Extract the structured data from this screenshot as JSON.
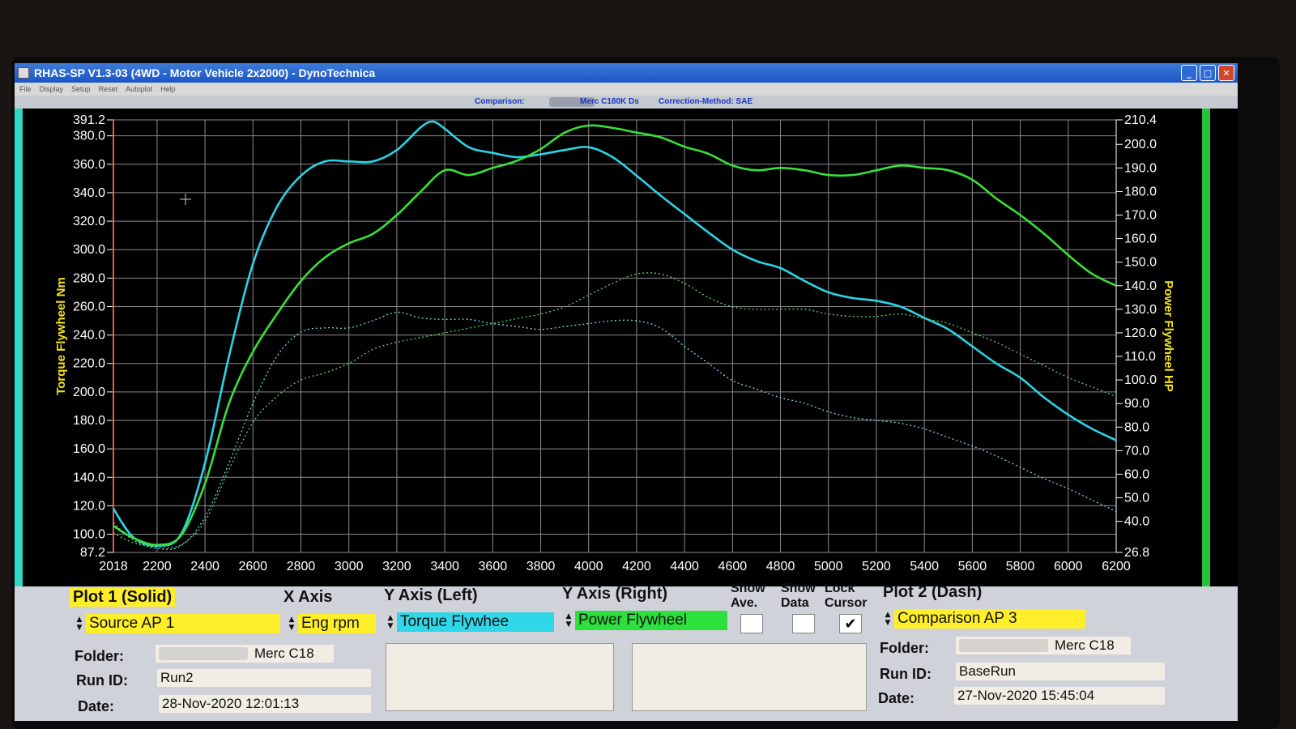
{
  "window": {
    "title": "RHAS-SP V1.3-03  (4WD - Motor Vehicle 2x2000) - DynoTechnica",
    "menu": [
      "File",
      "Display",
      "Setup",
      "Reset",
      "Autoplot",
      "Help"
    ]
  },
  "infobar": {
    "comparison_label": "Comparison:",
    "comparison_value": "Merc C180K Ds",
    "correction_label": "Correction-Method: SAE"
  },
  "chart_data": {
    "type": "line",
    "xlabel": "",
    "ylabel": "Torque Flywheel Nm",
    "y2label": "Power Flywheel HP",
    "xlim": [
      2018,
      6200
    ],
    "ylim": [
      87.2,
      391.2
    ],
    "y2lim": [
      26.8,
      210.4
    ],
    "x_ticks": [
      2018,
      2200,
      2400,
      2600,
      2800,
      3000,
      3200,
      3400,
      3600,
      3800,
      4000,
      4200,
      4400,
      4600,
      4800,
      5000,
      5200,
      5400,
      5600,
      5800,
      6000,
      6200
    ],
    "y_ticks": [
      "391.2",
      "380.0",
      "360.0",
      "340.0",
      "320.0",
      "300.0",
      "280.0",
      "260.0",
      "240.0",
      "220.0",
      "200.0",
      "180.0",
      "160.0",
      "140.0",
      "120.0",
      "100.0",
      "87.2"
    ],
    "y2_ticks": [
      "210.4",
      "200.0",
      "190.0",
      "180.0",
      "170.0",
      "160.0",
      "150.0",
      "140.0",
      "130.0",
      "120.0",
      "110.0",
      "100.0",
      "90.0",
      "80.0",
      "70.0",
      "60.0",
      "50.0",
      "40.0",
      "26.8"
    ],
    "grid": true,
    "series": [
      {
        "name": "Torque Flywheel",
        "axis": "left",
        "style": "solid",
        "color": "#2ad4e6",
        "x": [
          2018,
          2100,
          2200,
          2300,
          2400,
          2500,
          2600,
          2700,
          2800,
          2900,
          3000,
          3100,
          3200,
          3300,
          3350,
          3400,
          3500,
          3600,
          3700,
          3800,
          3900,
          4000,
          4100,
          4200,
          4300,
          4400,
          4500,
          4600,
          4700,
          4800,
          4900,
          5000,
          5100,
          5200,
          5300,
          5400,
          5500,
          5600,
          5700,
          5800,
          5900,
          6000,
          6100,
          6200
        ],
        "y": [
          118,
          98,
          92,
          100,
          150,
          225,
          290,
          330,
          352,
          362,
          362,
          362,
          370,
          386,
          390,
          385,
          372,
          368,
          365,
          367,
          370,
          372,
          365,
          352,
          338,
          325,
          312,
          300,
          292,
          287,
          278,
          270,
          266,
          264,
          260,
          252,
          244,
          232,
          220,
          210,
          196,
          184,
          174,
          166
        ]
      },
      {
        "name": "Power Flywheel",
        "axis": "right",
        "style": "solid",
        "color": "#38e03a",
        "x": [
          2018,
          2100,
          2200,
          2300,
          2400,
          2500,
          2600,
          2700,
          2800,
          2900,
          3000,
          3100,
          3200,
          3300,
          3400,
          3500,
          3600,
          3700,
          3800,
          3900,
          4000,
          4100,
          4200,
          4300,
          4400,
          4500,
          4600,
          4700,
          4800,
          4900,
          5000,
          5100,
          5200,
          5300,
          5400,
          5500,
          5600,
          5700,
          5800,
          5900,
          6000,
          6100,
          6200
        ],
        "y": [
          38,
          33,
          30,
          34,
          56,
          90,
          112,
          128,
          142,
          152,
          158,
          162,
          170,
          180,
          189,
          187,
          190,
          193,
          198,
          205,
          208,
          207,
          205,
          203,
          199,
          196,
          191,
          189,
          190,
          189,
          187,
          187,
          189,
          191,
          190,
          189,
          185,
          177,
          170,
          162,
          153,
          145,
          140
        ]
      },
      {
        "name": "Torque Flywheel (Comparison)",
        "axis": "left",
        "style": "dotted",
        "color": "#6fd6e8",
        "x": [
          2018,
          2100,
          2200,
          2300,
          2400,
          2500,
          2600,
          2700,
          2800,
          2900,
          3000,
          3100,
          3200,
          3300,
          3400,
          3500,
          3600,
          3700,
          3800,
          3900,
          4000,
          4100,
          4200,
          4300,
          4400,
          4500,
          4600,
          4700,
          4800,
          4900,
          5000,
          5100,
          5200,
          5300,
          5400,
          5500,
          5600,
          5700,
          5800,
          5900,
          6000,
          6100,
          6200
        ],
        "y": [
          108,
          96,
          90,
          92,
          112,
          150,
          192,
          225,
          242,
          245,
          245,
          250,
          256,
          252,
          251,
          251,
          248,
          246,
          244,
          246,
          248,
          250,
          250,
          245,
          232,
          220,
          208,
          202,
          196,
          192,
          186,
          182,
          180,
          178,
          174,
          168,
          162,
          155,
          147,
          139,
          132,
          124,
          116
        ]
      },
      {
        "name": "Power Flywheel (Comparison)",
        "axis": "right",
        "style": "dotted",
        "color": "#5cd85c",
        "x": [
          2018,
          2100,
          2200,
          2300,
          2400,
          2500,
          2600,
          2700,
          2800,
          2900,
          3000,
          3100,
          3200,
          3300,
          3400,
          3500,
          3600,
          3700,
          3800,
          3900,
          4000,
          4100,
          4200,
          4300,
          4400,
          4500,
          4600,
          4700,
          4800,
          4900,
          5000,
          5100,
          5200,
          5300,
          5400,
          5500,
          5600,
          5700,
          5800,
          5900,
          6000,
          6100,
          6200
        ],
        "y": [
          35,
          31,
          29,
          30,
          40,
          62,
          82,
          93,
          100,
          103,
          107,
          113,
          116,
          118,
          120,
          122,
          124,
          126,
          128,
          131,
          136,
          141,
          145,
          145,
          141,
          135,
          131,
          130,
          130,
          130,
          128,
          127,
          127,
          128,
          126,
          124,
          120,
          116,
          111,
          106,
          101,
          97,
          93
        ]
      }
    ]
  },
  "panel": {
    "plot1_label": "Plot 1 (Solid)",
    "xaxis_label": "X Axis",
    "yleft_label": "Y Axis (Left)",
    "yright_label": "Y Axis (Right)",
    "show_ave_label_1": "Show",
    "show_ave_label_2": "Ave.",
    "show_data_label_1": "Show",
    "show_data_label_2": "Data",
    "lock_cursor_label_1": "Lock",
    "lock_cursor_label_2": "Cursor",
    "plot2_label": "Plot 2 (Dash)",
    "source_select": "Source AP 1",
    "xaxis_select": "Eng rpm",
    "yleft_select": "Torque Flywhee",
    "yright_select": "Power Flywheel",
    "lock_cursor_mark": "✔",
    "comparison_select": "Comparison AP 3",
    "folder_label": "Folder:",
    "runid_label": "Run ID:",
    "date_label": "Date:",
    "plot1_folder": "Merc C18",
    "plot1_runid": "Run2",
    "plot1_date": "28-Nov-2020  12:01:13",
    "plot2_folder": "Merc C18",
    "plot2_runid": "BaseRun",
    "plot2_date": "27-Nov-2020  15:45:04"
  }
}
